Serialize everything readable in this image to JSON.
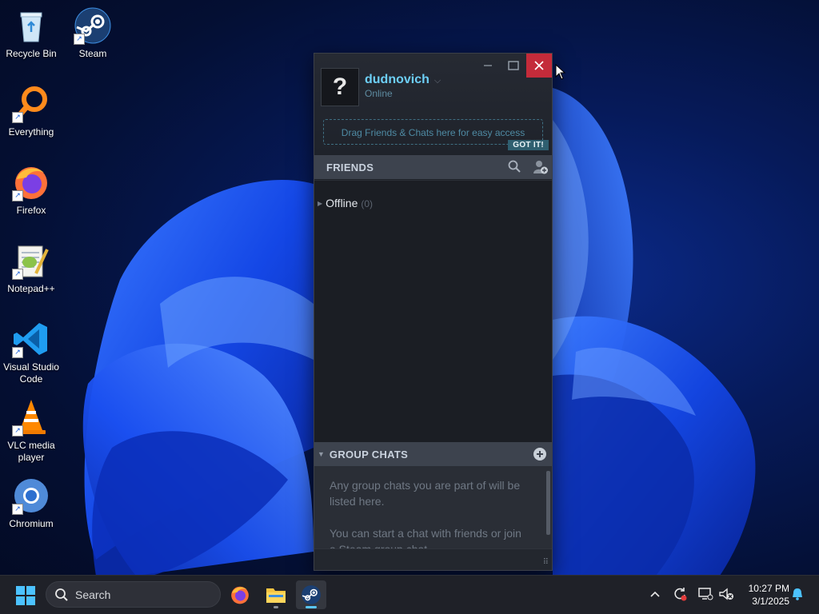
{
  "desktop": {
    "icons": [
      {
        "label": "Recycle Bin"
      },
      {
        "label": "Steam"
      },
      {
        "label": "Everything"
      },
      {
        "label": "Firefox"
      },
      {
        "label": "Notepad++"
      },
      {
        "label": "Visual Studio Code"
      },
      {
        "label": "VLC media player"
      },
      {
        "label": "Chromium"
      }
    ]
  },
  "steam": {
    "avatar_glyph": "?",
    "username": "dudnovich",
    "status": "Online",
    "drag_hint": "Drag Friends & Chats here for easy access",
    "got_it": "GOT IT!",
    "friends_header": "FRIENDS",
    "offline_label": "Offline",
    "offline_count": "(0)",
    "group_chats_header": "GROUP CHATS",
    "group_chats_text_1": "Any group chats you are part of will be listed here.",
    "group_chats_text_2": "You can start a chat with friends or join a Steam group chat."
  },
  "taskbar": {
    "search_placeholder": "Search",
    "time": "10:27 PM",
    "date": "3/1/2025"
  },
  "colors": {
    "accent_blue": "#6dcff6",
    "close_red": "#c42b3a"
  }
}
